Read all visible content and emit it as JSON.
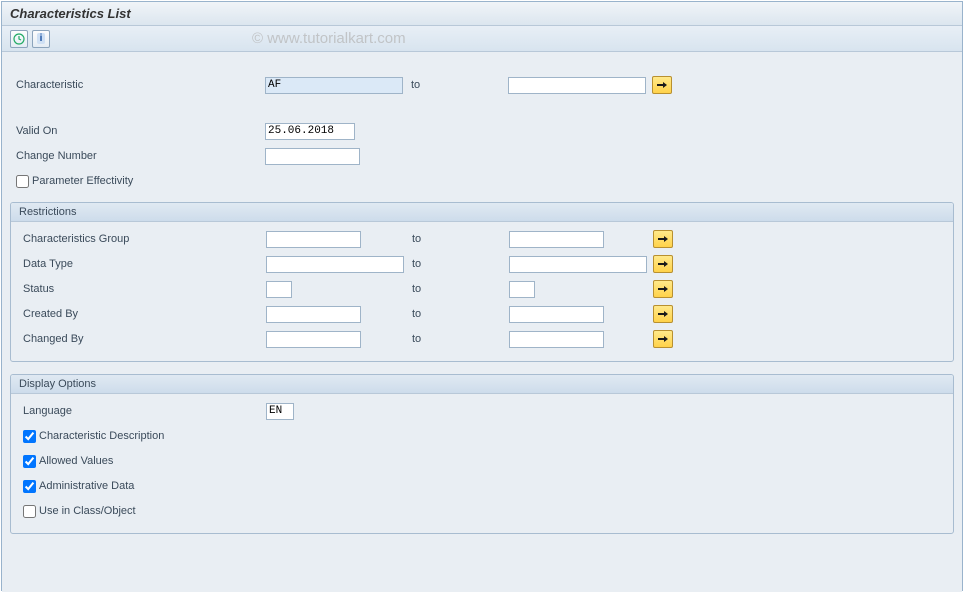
{
  "header": {
    "title": "Characteristics List"
  },
  "watermark": "© www.tutorialkart.com",
  "selection": {
    "characteristic_label": "Characteristic",
    "characteristic_from": "AF",
    "characteristic_to": "",
    "to_label": "to",
    "valid_on_label": "Valid On",
    "valid_on_value": "25.06.2018",
    "change_number_label": "Change Number",
    "change_number_value": "",
    "parameter_effectivity_label": "Parameter Effectivity",
    "parameter_effectivity_checked": false
  },
  "restrictions": {
    "group_title": "Restrictions",
    "rows": [
      {
        "label": "Characteristics Group",
        "from": "",
        "to": "",
        "from_w": "w-med",
        "to_w": "w-med"
      },
      {
        "label": "Data Type",
        "from": "",
        "to": "",
        "from_w": "w-large",
        "to_w": "w-large"
      },
      {
        "label": "Status",
        "from": "",
        "to": "",
        "from_w": "w-sm",
        "to_w": "w-sm"
      },
      {
        "label": "Created By",
        "from": "",
        "to": "",
        "from_w": "w-med",
        "to_w": "w-med"
      },
      {
        "label": "Changed By",
        "from": "",
        "to": "",
        "from_w": "w-med",
        "to_w": "w-med"
      }
    ]
  },
  "display": {
    "group_title": "Display Options",
    "language_label": "Language",
    "language_value": "EN",
    "opts": [
      {
        "label": "Characteristic Description",
        "checked": true
      },
      {
        "label": "Allowed Values",
        "checked": true
      },
      {
        "label": "Administrative Data",
        "checked": true
      },
      {
        "label": "Use in Class/Object",
        "checked": false
      }
    ]
  }
}
